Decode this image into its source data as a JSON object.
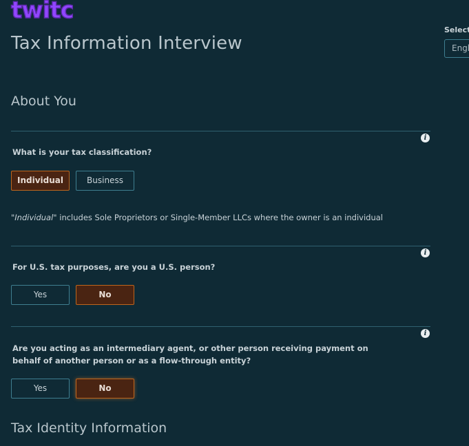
{
  "header": {
    "logo_text": "twitch",
    "title": "Tax Information Interview",
    "language_label": "Select",
    "language_value": "Engl"
  },
  "sections": {
    "about_you": "About You",
    "tax_identity": "Tax Identity Information"
  },
  "questions": {
    "classification": {
      "label": "What is your tax classification?",
      "options": [
        "Individual",
        "Business"
      ],
      "selected": "Individual",
      "note_emphasis": "\"Individual\"",
      "note_rest": " includes Sole Proprietors or Single-Member LLCs where the owner is an individual"
    },
    "us_person": {
      "label": "For U.S. tax purposes, are you a U.S. person?",
      "options": [
        "Yes",
        "No"
      ],
      "selected": "No"
    },
    "intermediary": {
      "label": "Are you acting as an intermediary agent, or other person receiving payment on behalf of another person or as a flow-through entity?",
      "options": [
        "Yes",
        "No"
      ],
      "selected": "No"
    }
  },
  "colors": {
    "background": "#0f2a35",
    "logo": "#9146ff",
    "selected_border": "#c0661d",
    "selected_fill": "#4a2412",
    "outline": "#3f7f91"
  }
}
